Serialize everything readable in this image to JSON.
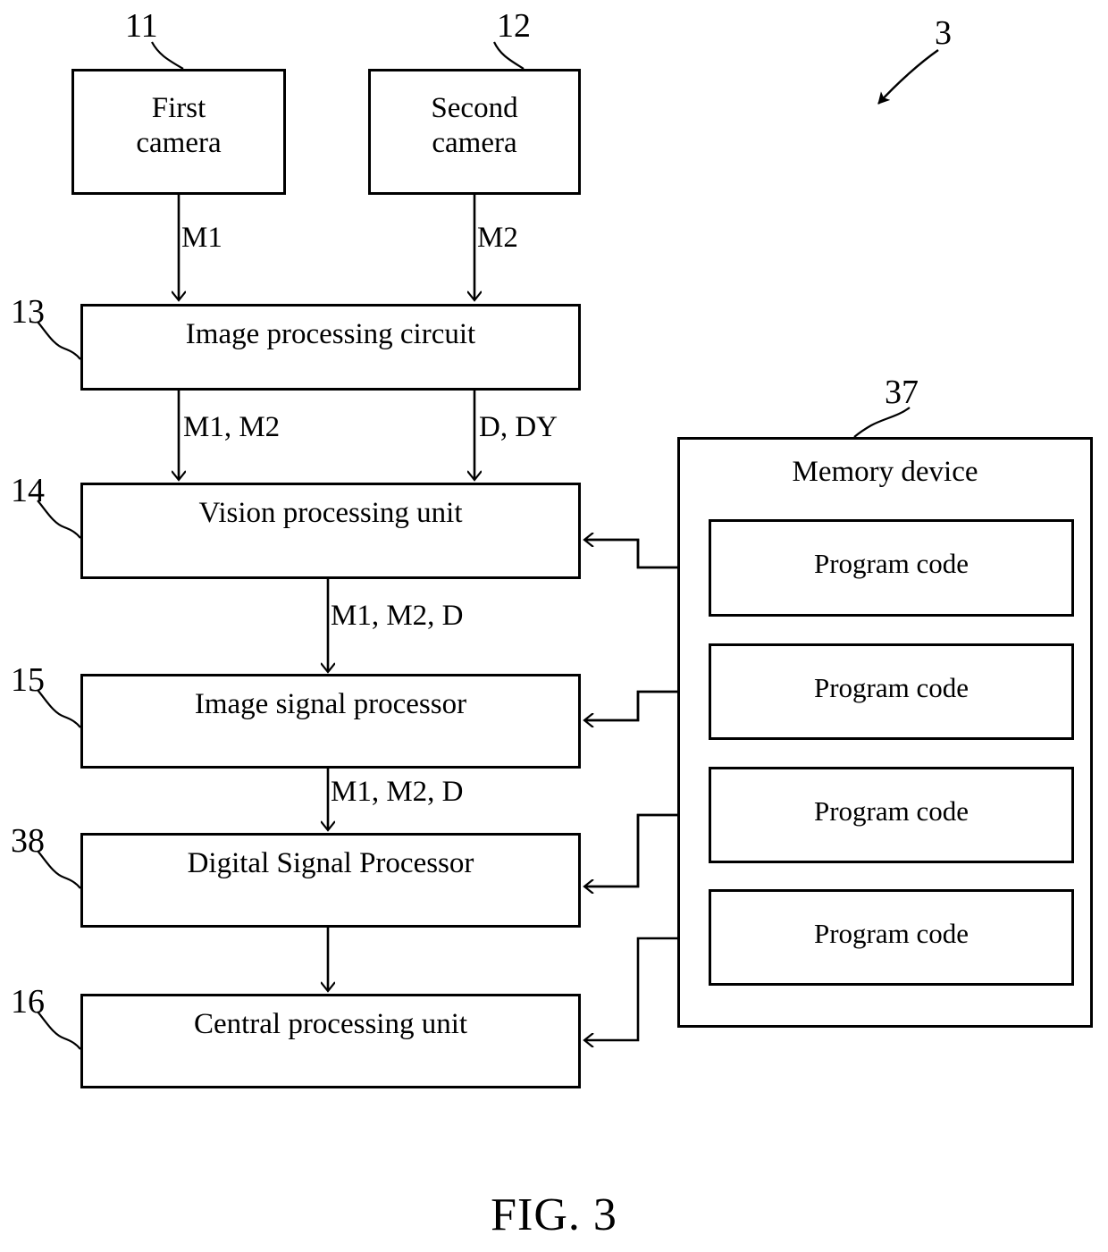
{
  "figure": {
    "caption": "FIG. 3",
    "system_ref": "3"
  },
  "nodes": [
    {
      "id": "first_camera",
      "label": "First\ncamera",
      "ref": "11"
    },
    {
      "id": "second_camera",
      "label": "Second\ncamera",
      "ref": "12"
    },
    {
      "id": "image_proc",
      "label": "Image processing circuit",
      "ref": "13"
    },
    {
      "id": "vision_unit",
      "label": "Vision processing unit",
      "ref": "14"
    },
    {
      "id": "isp",
      "label": "Image signal processor",
      "ref": "15"
    },
    {
      "id": "dsp",
      "label": "Digital Signal Processor",
      "ref": "38"
    },
    {
      "id": "cpu",
      "label": "Central processing unit",
      "ref": "16"
    }
  ],
  "memory": {
    "title": "Memory device",
    "ref": "37",
    "blocks": [
      {
        "label": "Program code"
      },
      {
        "label": "Program code"
      },
      {
        "label": "Program code"
      },
      {
        "label": "Program code"
      }
    ]
  },
  "edge_labels": [
    {
      "id": "e1",
      "text": "M1"
    },
    {
      "id": "e2",
      "text": "M2"
    },
    {
      "id": "e3",
      "text": "M1, M2"
    },
    {
      "id": "e4",
      "text": "D, DY"
    },
    {
      "id": "e5",
      "text": "M1, M2, D"
    },
    {
      "id": "e6",
      "text": "M1, M2, D"
    }
  ],
  "colors": {
    "stroke": "#000000",
    "background": "#ffffff"
  }
}
